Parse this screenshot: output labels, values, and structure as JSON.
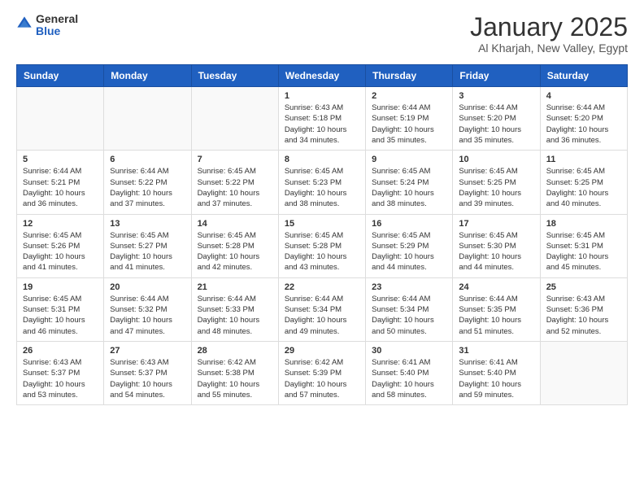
{
  "logo": {
    "general": "General",
    "blue": "Blue"
  },
  "title": "January 2025",
  "subtitle": "Al Kharjah, New Valley, Egypt",
  "weekdays": [
    "Sunday",
    "Monday",
    "Tuesday",
    "Wednesday",
    "Thursday",
    "Friday",
    "Saturday"
  ],
  "weeks": [
    [
      {
        "day": "",
        "info": ""
      },
      {
        "day": "",
        "info": ""
      },
      {
        "day": "",
        "info": ""
      },
      {
        "day": "1",
        "info": "Sunrise: 6:43 AM\nSunset: 5:18 PM\nDaylight: 10 hours\nand 34 minutes."
      },
      {
        "day": "2",
        "info": "Sunrise: 6:44 AM\nSunset: 5:19 PM\nDaylight: 10 hours\nand 35 minutes."
      },
      {
        "day": "3",
        "info": "Sunrise: 6:44 AM\nSunset: 5:20 PM\nDaylight: 10 hours\nand 35 minutes."
      },
      {
        "day": "4",
        "info": "Sunrise: 6:44 AM\nSunset: 5:20 PM\nDaylight: 10 hours\nand 36 minutes."
      }
    ],
    [
      {
        "day": "5",
        "info": "Sunrise: 6:44 AM\nSunset: 5:21 PM\nDaylight: 10 hours\nand 36 minutes."
      },
      {
        "day": "6",
        "info": "Sunrise: 6:44 AM\nSunset: 5:22 PM\nDaylight: 10 hours\nand 37 minutes."
      },
      {
        "day": "7",
        "info": "Sunrise: 6:45 AM\nSunset: 5:22 PM\nDaylight: 10 hours\nand 37 minutes."
      },
      {
        "day": "8",
        "info": "Sunrise: 6:45 AM\nSunset: 5:23 PM\nDaylight: 10 hours\nand 38 minutes."
      },
      {
        "day": "9",
        "info": "Sunrise: 6:45 AM\nSunset: 5:24 PM\nDaylight: 10 hours\nand 38 minutes."
      },
      {
        "day": "10",
        "info": "Sunrise: 6:45 AM\nSunset: 5:25 PM\nDaylight: 10 hours\nand 39 minutes."
      },
      {
        "day": "11",
        "info": "Sunrise: 6:45 AM\nSunset: 5:25 PM\nDaylight: 10 hours\nand 40 minutes."
      }
    ],
    [
      {
        "day": "12",
        "info": "Sunrise: 6:45 AM\nSunset: 5:26 PM\nDaylight: 10 hours\nand 41 minutes."
      },
      {
        "day": "13",
        "info": "Sunrise: 6:45 AM\nSunset: 5:27 PM\nDaylight: 10 hours\nand 41 minutes."
      },
      {
        "day": "14",
        "info": "Sunrise: 6:45 AM\nSunset: 5:28 PM\nDaylight: 10 hours\nand 42 minutes."
      },
      {
        "day": "15",
        "info": "Sunrise: 6:45 AM\nSunset: 5:28 PM\nDaylight: 10 hours\nand 43 minutes."
      },
      {
        "day": "16",
        "info": "Sunrise: 6:45 AM\nSunset: 5:29 PM\nDaylight: 10 hours\nand 44 minutes."
      },
      {
        "day": "17",
        "info": "Sunrise: 6:45 AM\nSunset: 5:30 PM\nDaylight: 10 hours\nand 44 minutes."
      },
      {
        "day": "18",
        "info": "Sunrise: 6:45 AM\nSunset: 5:31 PM\nDaylight: 10 hours\nand 45 minutes."
      }
    ],
    [
      {
        "day": "19",
        "info": "Sunrise: 6:45 AM\nSunset: 5:31 PM\nDaylight: 10 hours\nand 46 minutes."
      },
      {
        "day": "20",
        "info": "Sunrise: 6:44 AM\nSunset: 5:32 PM\nDaylight: 10 hours\nand 47 minutes."
      },
      {
        "day": "21",
        "info": "Sunrise: 6:44 AM\nSunset: 5:33 PM\nDaylight: 10 hours\nand 48 minutes."
      },
      {
        "day": "22",
        "info": "Sunrise: 6:44 AM\nSunset: 5:34 PM\nDaylight: 10 hours\nand 49 minutes."
      },
      {
        "day": "23",
        "info": "Sunrise: 6:44 AM\nSunset: 5:34 PM\nDaylight: 10 hours\nand 50 minutes."
      },
      {
        "day": "24",
        "info": "Sunrise: 6:44 AM\nSunset: 5:35 PM\nDaylight: 10 hours\nand 51 minutes."
      },
      {
        "day": "25",
        "info": "Sunrise: 6:43 AM\nSunset: 5:36 PM\nDaylight: 10 hours\nand 52 minutes."
      }
    ],
    [
      {
        "day": "26",
        "info": "Sunrise: 6:43 AM\nSunset: 5:37 PM\nDaylight: 10 hours\nand 53 minutes."
      },
      {
        "day": "27",
        "info": "Sunrise: 6:43 AM\nSunset: 5:37 PM\nDaylight: 10 hours\nand 54 minutes."
      },
      {
        "day": "28",
        "info": "Sunrise: 6:42 AM\nSunset: 5:38 PM\nDaylight: 10 hours\nand 55 minutes."
      },
      {
        "day": "29",
        "info": "Sunrise: 6:42 AM\nSunset: 5:39 PM\nDaylight: 10 hours\nand 57 minutes."
      },
      {
        "day": "30",
        "info": "Sunrise: 6:41 AM\nSunset: 5:40 PM\nDaylight: 10 hours\nand 58 minutes."
      },
      {
        "day": "31",
        "info": "Sunrise: 6:41 AM\nSunset: 5:40 PM\nDaylight: 10 hours\nand 59 minutes."
      },
      {
        "day": "",
        "info": ""
      }
    ]
  ]
}
